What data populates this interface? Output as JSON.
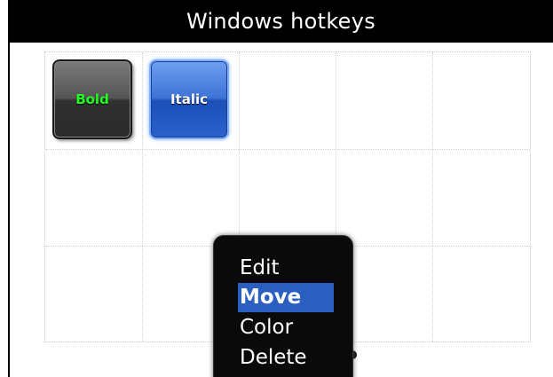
{
  "title": "Windows hotkeys",
  "hotkeys": [
    {
      "label": "Bold",
      "text_color": "#22ff22",
      "style": "dark"
    },
    {
      "label": "Italic",
      "text_color": "#ffffff",
      "style": "blue-focused"
    }
  ],
  "context_menu": {
    "items": [
      {
        "label": "Edit",
        "selected": false
      },
      {
        "label": "Move",
        "selected": true
      },
      {
        "label": "Color",
        "selected": false
      },
      {
        "label": "Delete",
        "selected": false
      }
    ],
    "selected_color": "#2a5fbf"
  },
  "colors": {
    "titlebar_bg": "#000000",
    "titlebar_text": "#ffffff",
    "grid_line": "#cfcfcf"
  }
}
